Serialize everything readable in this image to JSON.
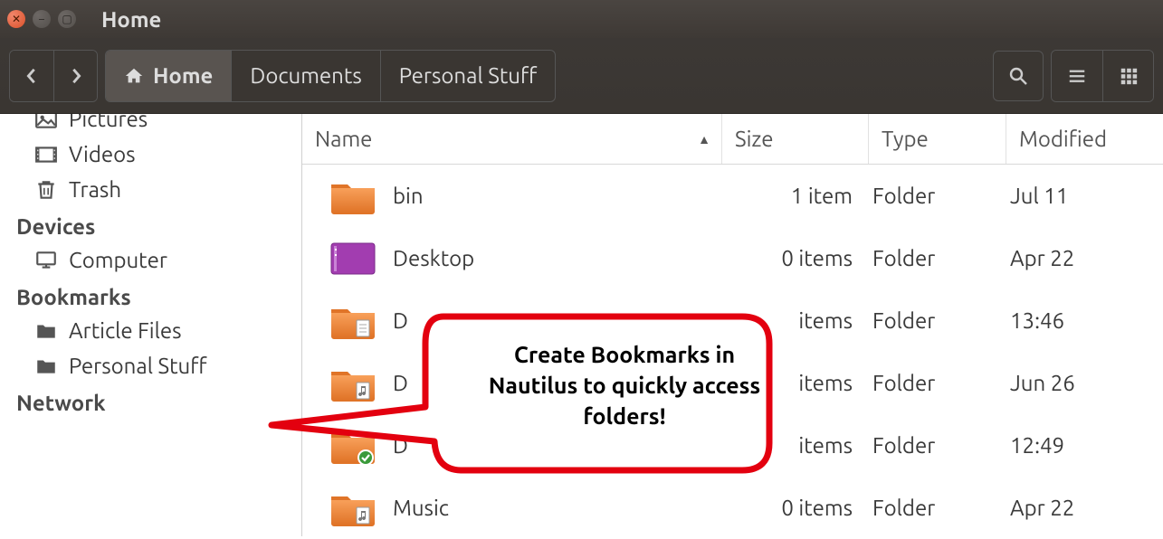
{
  "window": {
    "title": "Home"
  },
  "toolbar": {
    "path": [
      {
        "label": "Home",
        "active": true,
        "icon": "home"
      },
      {
        "label": "Documents",
        "active": false
      },
      {
        "label": "Personal Stuff",
        "active": false
      }
    ]
  },
  "sidebar": {
    "places": [
      {
        "label": "Pictures",
        "icon": "pictures"
      },
      {
        "label": "Videos",
        "icon": "videos"
      },
      {
        "label": "Trash",
        "icon": "trash"
      }
    ],
    "devices_header": "Devices",
    "devices": [
      {
        "label": "Computer",
        "icon": "computer"
      }
    ],
    "bookmarks_header": "Bookmarks",
    "bookmarks": [
      {
        "label": "Article Files",
        "icon": "folder"
      },
      {
        "label": "Personal Stuff",
        "icon": "folder"
      }
    ],
    "network_header": "Network"
  },
  "columns": {
    "name": "Name",
    "size": "Size",
    "type": "Type",
    "modified": "Modified"
  },
  "files": [
    {
      "name": "bin",
      "size": "1 item",
      "type": "Folder",
      "modified": "Jul 11",
      "icon": "folder"
    },
    {
      "name": "Desktop",
      "size": "0 items",
      "type": "Folder",
      "modified": "Apr 22",
      "icon": "desktop"
    },
    {
      "name": "D",
      "size": "items",
      "type": "Folder",
      "modified": "13:46",
      "icon": "folder-doc"
    },
    {
      "name": "D",
      "size": "items",
      "type": "Folder",
      "modified": "Jun 26",
      "icon": "folder-music"
    },
    {
      "name": "D",
      "size": "items",
      "type": "Folder",
      "modified": "12:49",
      "icon": "folder-check"
    },
    {
      "name": "Music",
      "size": "0 items",
      "type": "Folder",
      "modified": "Apr 22",
      "icon": "folder-music2"
    }
  ],
  "callout": {
    "text": "Create Bookmarks in Nautilus to quickly access folders!"
  },
  "colors": {
    "folder_light": "#f8a05a",
    "folder_dark": "#e07428",
    "desktop": "#a23db0"
  }
}
